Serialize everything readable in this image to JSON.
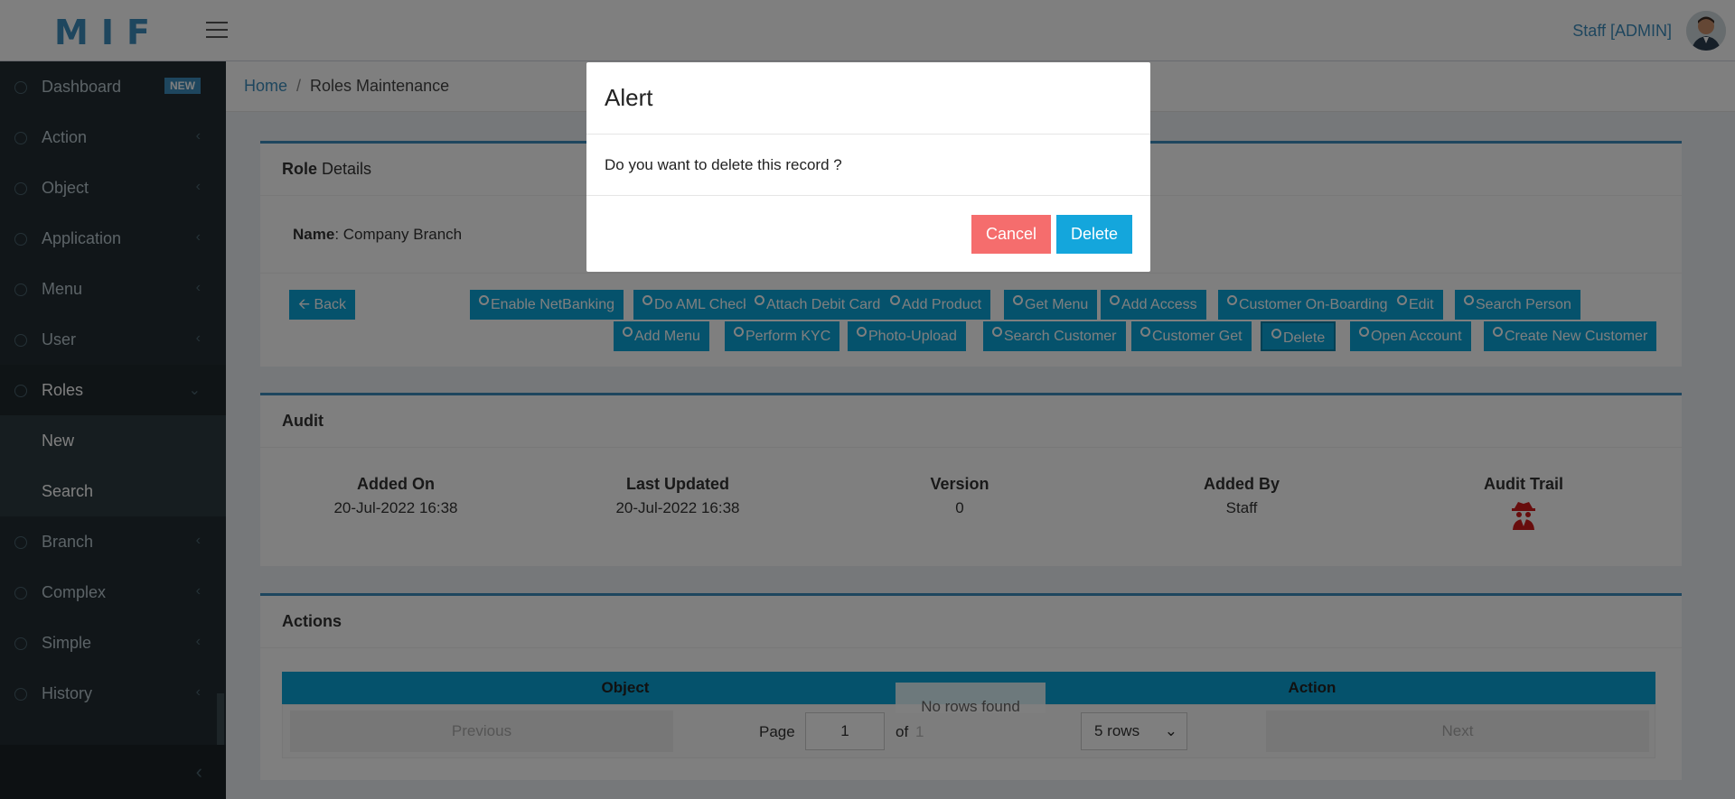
{
  "header": {
    "logo": "MIF",
    "user": "Staff [ADMIN]"
  },
  "sidebar": {
    "items": [
      {
        "label": "Dashboard",
        "badge": "NEW"
      },
      {
        "label": "Action"
      },
      {
        "label": "Object"
      },
      {
        "label": "Application"
      },
      {
        "label": "Menu"
      },
      {
        "label": "User"
      },
      {
        "label": "Roles"
      },
      {
        "label": "New"
      },
      {
        "label": "Search"
      },
      {
        "label": "Branch"
      },
      {
        "label": "Complex"
      },
      {
        "label": "Simple"
      },
      {
        "label": "History"
      }
    ],
    "collapse_icon": "chevron-left-icon"
  },
  "breadcrumb": {
    "home": "Home",
    "separator": "/",
    "current": "Roles Maintenance"
  },
  "role": {
    "title_bold": "Role",
    "title_rest": " Details",
    "name_label": "Name",
    "name_value": ": Company Branch",
    "back": "Back",
    "buttons_row1": [
      "Enable NetBanking",
      "Do AML Check",
      "Attach Debit Card",
      "Add Product",
      "Get Menu",
      "Add Access",
      "Customer On-Boarding",
      "Edit",
      "Search Person"
    ],
    "buttons_row2": [
      "Add Menu",
      "Perform KYC",
      "Photo-Upload",
      "Search Customer",
      "Customer Get",
      "Delete",
      "Open Account",
      "Create New Customer"
    ]
  },
  "audit": {
    "title": "Audit",
    "added_on_label": "Added On",
    "added_on": "20-Jul-2022 16:38",
    "last_updated_label": "Last Updated",
    "last_updated": "20-Jul-2022 16:38",
    "version_label": "Version",
    "version": "0",
    "added_by_label": "Added By",
    "added_by": "Staff",
    "audit_trail_label": "Audit Trail"
  },
  "actions": {
    "title": "Actions",
    "columns": [
      "Object",
      "Action"
    ],
    "empty": "No rows found",
    "previous": "Previous",
    "page_label": "Page",
    "page": "1",
    "of_label": "of",
    "total_pages": "1",
    "rows_option": "5 rows",
    "next": "Next"
  },
  "modal": {
    "title": "Alert",
    "message": "Do you want to delete this record ?",
    "cancel": "Cancel",
    "delete": "Delete"
  },
  "colors": {
    "primary": "#3c8dbc",
    "button": "#0aa5d8",
    "danger": "#f56d6d",
    "sidebar": "#222d32"
  }
}
